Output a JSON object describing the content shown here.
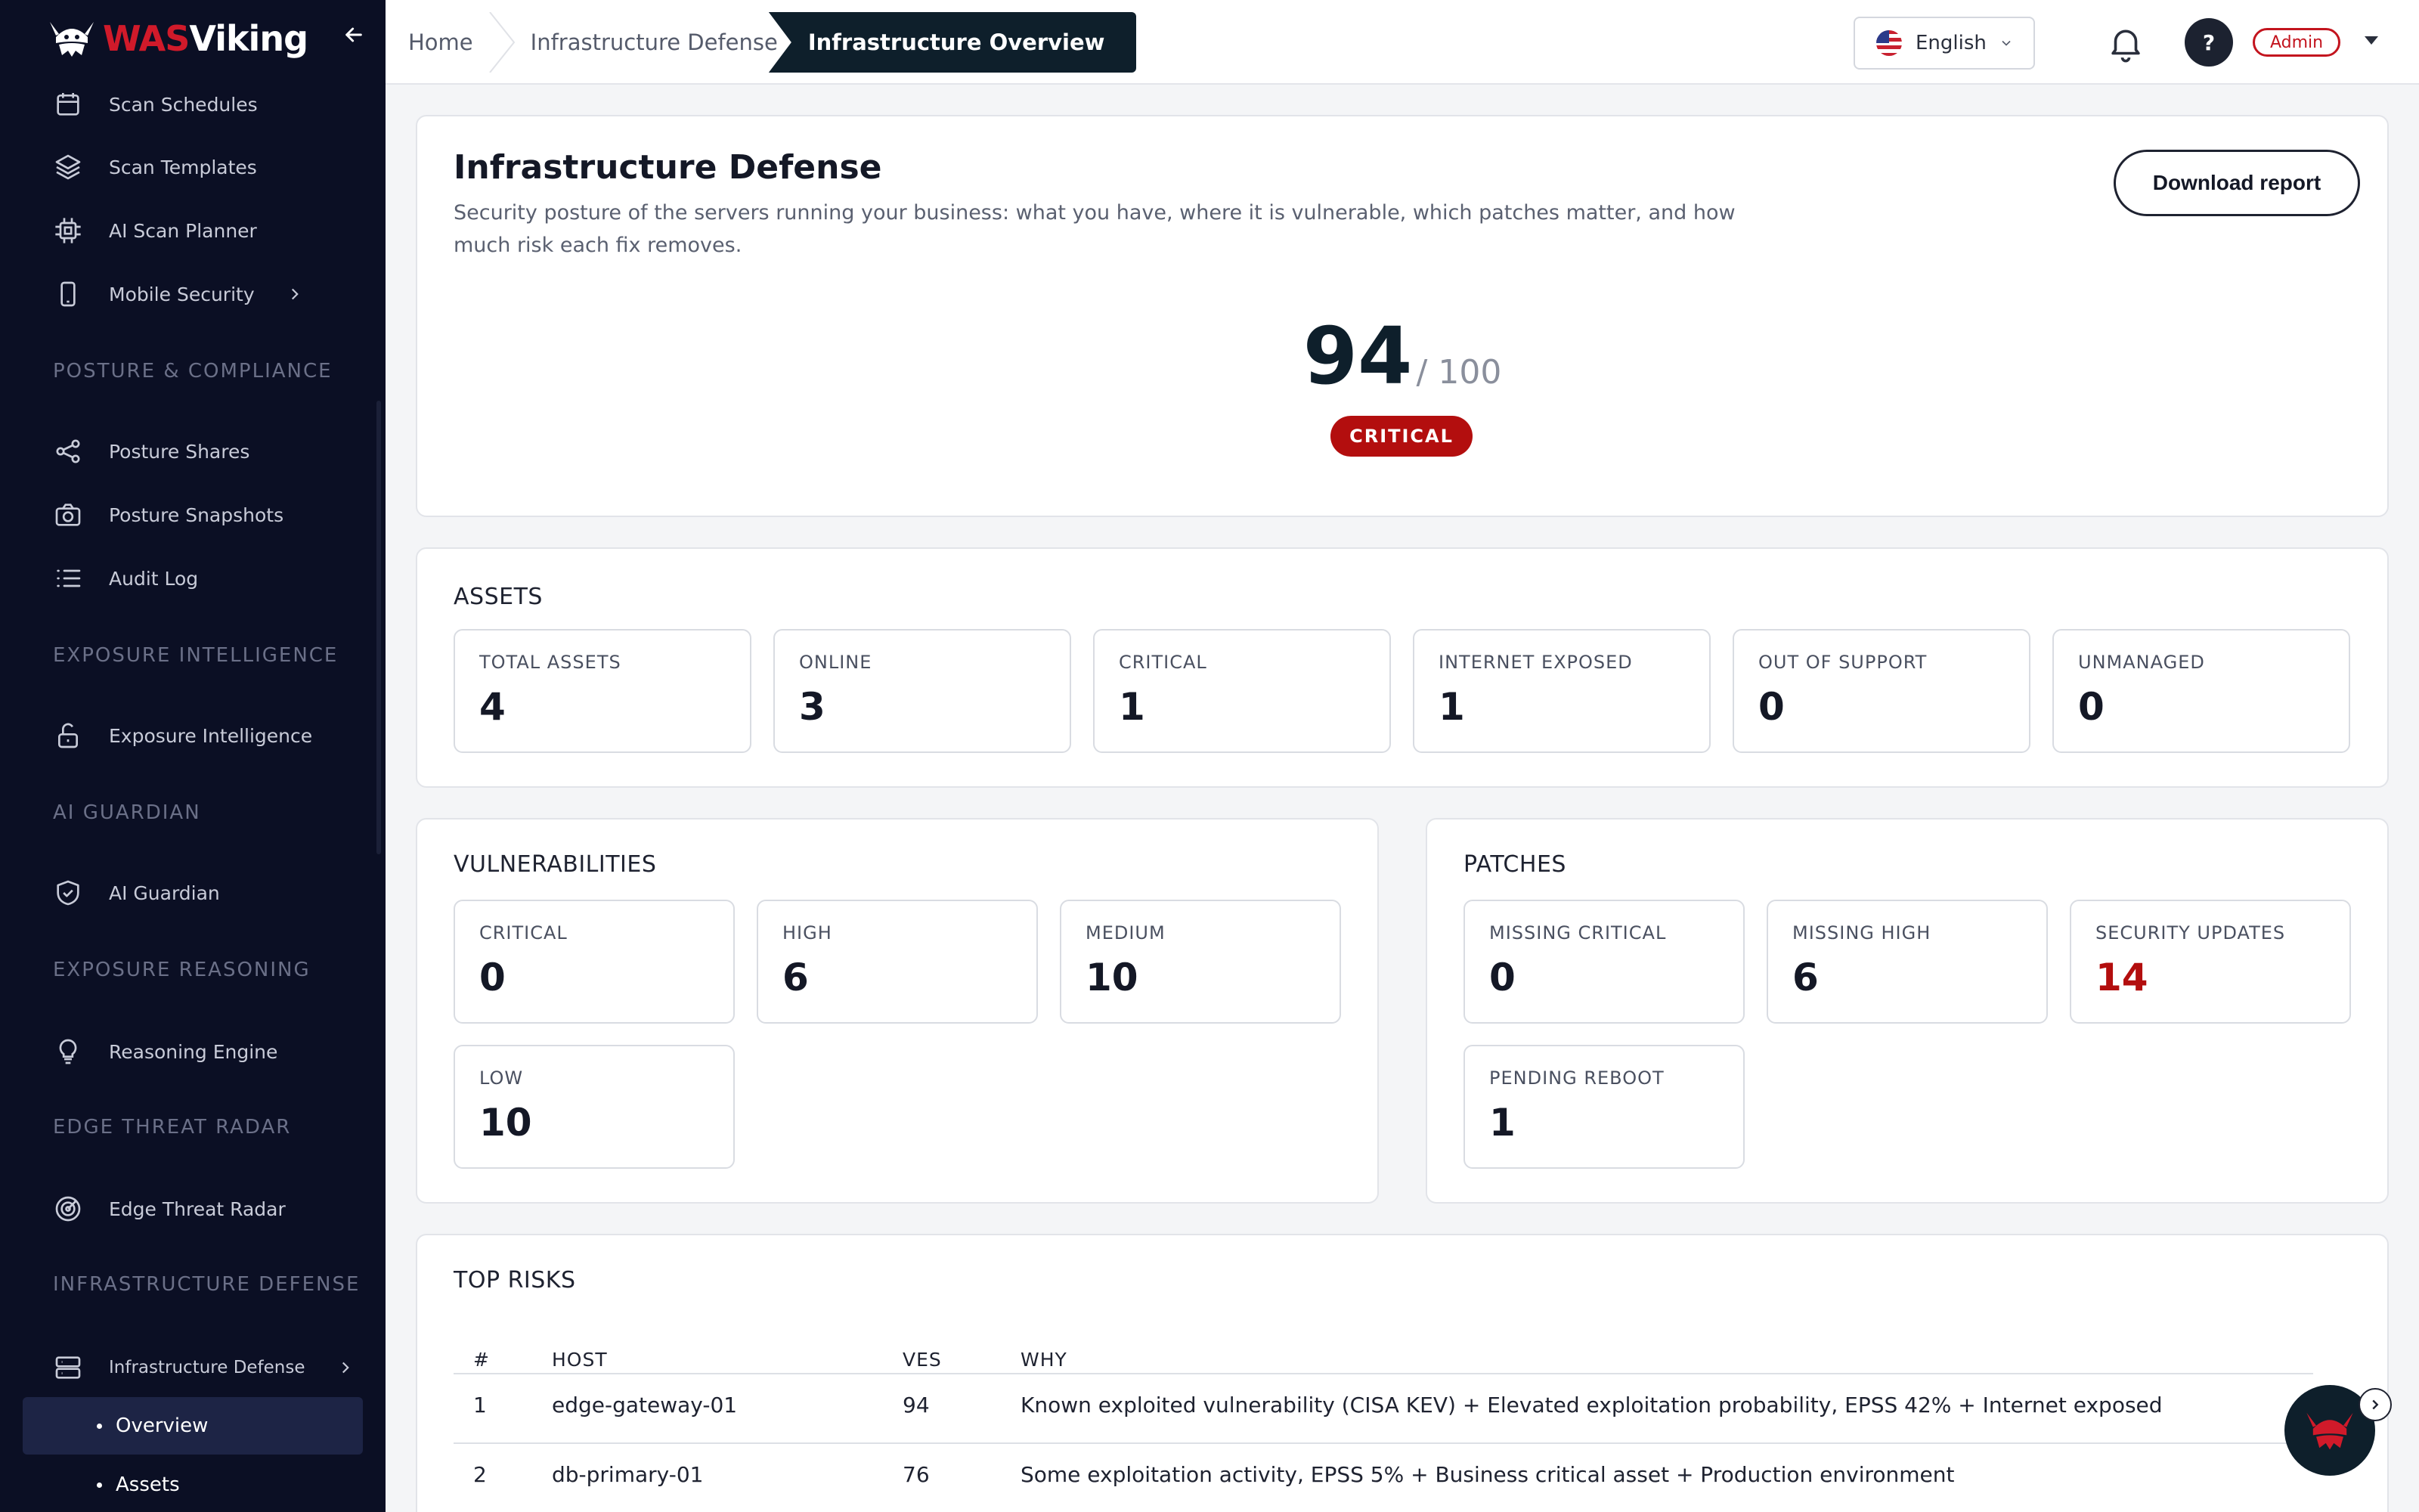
{
  "brand": {
    "was": "WAS",
    "viking": "Viking"
  },
  "sidebar": {
    "items_top": [
      {
        "label": "Scan Schedules"
      },
      {
        "label": "Scan Templates"
      },
      {
        "label": "AI Scan Planner"
      },
      {
        "label": "Mobile Security"
      }
    ],
    "sections": {
      "posture": "POSTURE & COMPLIANCE",
      "exposure": "EXPOSURE INTELLIGENCE",
      "guardian": "AI GUARDIAN",
      "reasoning": "EXPOSURE REASONING",
      "edge": "EDGE THREAT RADAR",
      "infra": "INFRASTRUCTURE DEFENSE"
    },
    "posture_items": [
      {
        "label": "Posture Shares"
      },
      {
        "label": "Posture Snapshots"
      },
      {
        "label": "Audit Log"
      }
    ],
    "exposure_item": "Exposure Intelligence",
    "guardian_item": "AI Guardian",
    "reasoning_item": "Reasoning Engine",
    "edge_item": "Edge Threat Radar",
    "infra_item": "Infrastructure Defense",
    "infra_sub": [
      {
        "label": "Overview"
      },
      {
        "label": "Assets"
      }
    ]
  },
  "topbar": {
    "breadcrumbs": [
      "Home",
      "Infrastructure Defense",
      "Infrastructure Overview"
    ],
    "language": "English",
    "help": "?",
    "role": "Admin"
  },
  "hero": {
    "title": "Infrastructure Defense",
    "subtitle": "Security posture of the servers running your business: what you have, where it is vulnerable, which patches matter, and how much risk each fix removes.",
    "download": "Download report",
    "score": "94",
    "score_max": "/ 100",
    "severity": "CRITICAL"
  },
  "assets": {
    "title": "ASSETS",
    "tiles": [
      {
        "label": "TOTAL ASSETS",
        "value": "4"
      },
      {
        "label": "ONLINE",
        "value": "3"
      },
      {
        "label": "CRITICAL",
        "value": "1"
      },
      {
        "label": "INTERNET EXPOSED",
        "value": "1"
      },
      {
        "label": "OUT OF SUPPORT",
        "value": "0"
      },
      {
        "label": "UNMANAGED",
        "value": "0"
      }
    ]
  },
  "vulnerabilities": {
    "title": "VULNERABILITIES",
    "tiles": [
      {
        "label": "CRITICAL",
        "value": "0"
      },
      {
        "label": "HIGH",
        "value": "6"
      },
      {
        "label": "MEDIUM",
        "value": "10"
      },
      {
        "label": "LOW",
        "value": "10"
      }
    ]
  },
  "patches": {
    "title": "PATCHES",
    "tiles": [
      {
        "label": "MISSING CRITICAL",
        "value": "0"
      },
      {
        "label": "MISSING HIGH",
        "value": "6"
      },
      {
        "label": "SECURITY UPDATES",
        "value": "14"
      },
      {
        "label": "PENDING REBOOT",
        "value": "1"
      }
    ]
  },
  "top_risks": {
    "title": "TOP RISKS",
    "columns": [
      "#",
      "HOST",
      "VES",
      "WHY"
    ],
    "rows": [
      {
        "n": "1",
        "host": "edge-gateway-01",
        "ves": "94",
        "why": "Known exploited vulnerability (CISA KEV) + Elevated exploitation probability, EPSS 42% + Internet exposed"
      },
      {
        "n": "2",
        "host": "db-primary-01",
        "ves": "76",
        "why": "Some exploitation activity, EPSS 5% + Business critical asset + Production environment"
      }
    ]
  },
  "colors": {
    "accent": "#b30e0e",
    "brand_red": "#d11a2a",
    "dark": "#0e1f2b",
    "sidebar": "#0b0f24"
  }
}
